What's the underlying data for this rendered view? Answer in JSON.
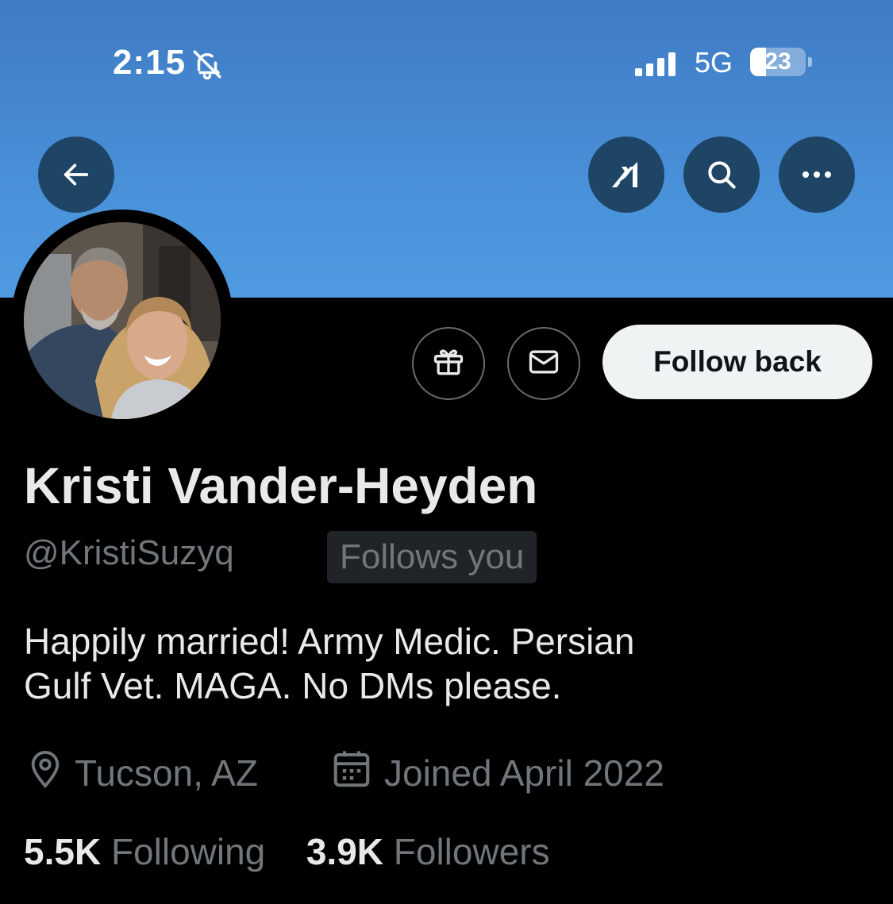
{
  "status_bar": {
    "time": "2:15",
    "network": "5G",
    "battery": "23"
  },
  "profile": {
    "name": "Kristi Vander-Heyden",
    "handle": "@KristiSuzyq",
    "follows_you_badge": "Follows you",
    "bio_line_1": "Happily married! Army Medic. Persian",
    "bio_line_2": "Gulf Vet. MAGA. No DMs please.",
    "location": "Tucson, AZ",
    "joined": "Joined April 2022",
    "following_count": "5.5K",
    "following_label": "Following",
    "followers_count": "3.9K",
    "followers_label": "Followers"
  },
  "actions": {
    "follow_back_label": "Follow back"
  },
  "icons": {
    "back": "arrow-left-icon",
    "grok": "grok-icon",
    "search": "search-icon",
    "more": "more-icon",
    "gift": "gift-icon",
    "message": "mail-icon",
    "location": "location-pin-icon",
    "calendar": "calendar-icon",
    "bell": "bell-slash-icon",
    "signal": "cellular-signal-icon"
  },
  "colors": {
    "banner": "#4a93db",
    "background": "#000000",
    "primary_text": "#e7e9ea",
    "secondary_text": "#71767b",
    "follow_button": "#eff3f4"
  }
}
